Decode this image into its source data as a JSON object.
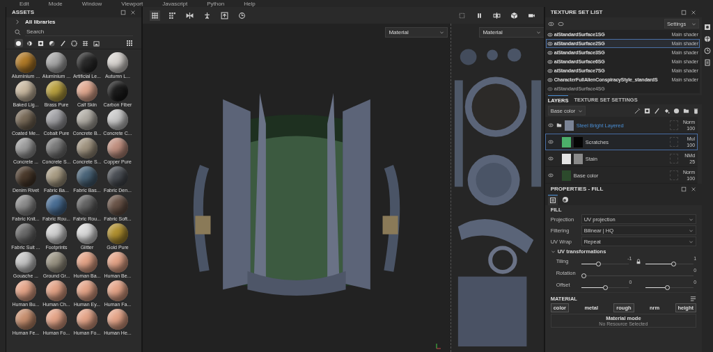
{
  "menu_bar": [
    "Edit",
    "Mode",
    "Window",
    "Viewport",
    "Javascript",
    "Python",
    "Help"
  ],
  "assets": {
    "title": "ASSETS",
    "library": "All libraries",
    "search": {
      "placeholder": "Search"
    },
    "filters": [
      {
        "kind": "sphere",
        "selected": true
      },
      {
        "kind": "smart",
        "selected": false
      },
      {
        "kind": "square",
        "selected": false
      },
      {
        "kind": "half",
        "selected": false
      },
      {
        "kind": "brush",
        "selected": false
      },
      {
        "kind": "particle",
        "selected": false
      },
      {
        "kind": "grid",
        "selected": false
      },
      {
        "kind": "image",
        "selected": false
      }
    ],
    "items": [
      {
        "name": "Aluminium ...",
        "color": "#b07a28"
      },
      {
        "name": "Aluminium ...",
        "color": "#a8a8a8"
      },
      {
        "name": "Artificial Le...",
        "color": "#2a2a2a"
      },
      {
        "name": "Autumn L...",
        "color": "#d8d4d0"
      },
      {
        "name": "Baked Lig...",
        "color": "#c8b8a0"
      },
      {
        "name": "Brass Pure",
        "color": "#b8a040"
      },
      {
        "name": "Calf Skin",
        "color": "#e0a890"
      },
      {
        "name": "Carbon Fiber",
        "color": "#1c1c1c"
      },
      {
        "name": "Coated Me...",
        "color": "#786a58"
      },
      {
        "name": "Cobalt Pure",
        "color": "#a0a0a4"
      },
      {
        "name": "Concrete B...",
        "color": "#b0aca4"
      },
      {
        "name": "Concrete C...",
        "color": "#c8c8c8"
      },
      {
        "name": "Concrete ...",
        "color": "#9c9c9c"
      },
      {
        "name": "Concrete S...",
        "color": "#7a7a7a"
      },
      {
        "name": "Concrete S...",
        "color": "#a09480"
      },
      {
        "name": "Copper Pure",
        "color": "#c09080"
      },
      {
        "name": "Denim Rivet",
        "color": "#4a3a2c"
      },
      {
        "name": "Fabric Ba...",
        "color": "#a89c84"
      },
      {
        "name": "Fabric Bas...",
        "color": "#4a6478"
      },
      {
        "name": "Fabric Den...",
        "color": "#4a4e54"
      },
      {
        "name": "Fabric Knit...",
        "color": "#8c8c8c"
      },
      {
        "name": "Fabric Rou...",
        "color": "#4a6e94"
      },
      {
        "name": "Fabric Rou...",
        "color": "#646464"
      },
      {
        "name": "Fabric Soft...",
        "color": "#6a5448"
      },
      {
        "name": "Fabric Suit ...",
        "color": "#6a6a6a"
      },
      {
        "name": "Footprints",
        "color": "#d0d0d0"
      },
      {
        "name": "Glitter",
        "color": "#d8d8d8"
      },
      {
        "name": "Gold Pure",
        "color": "#b09030"
      },
      {
        "name": "Gouache ...",
        "color": "#c4c4c4"
      },
      {
        "name": "Ground Gr...",
        "color": "#9a9484"
      },
      {
        "name": "Human Ba...",
        "color": "#e4a488"
      },
      {
        "name": "Human Be...",
        "color": "#e4a488"
      },
      {
        "name": "Human Bu...",
        "color": "#e4a488"
      },
      {
        "name": "Human Ch...",
        "color": "#e2a286"
      },
      {
        "name": "Human Ey...",
        "color": "#e4a488"
      },
      {
        "name": "Human Fa...",
        "color": "#e4a488"
      },
      {
        "name": "Human Fe...",
        "color": "#c89070"
      },
      {
        "name": "Human Fo...",
        "color": "#e4a488"
      },
      {
        "name": "Human Fo...",
        "color": "#e4a488"
      },
      {
        "name": "Human He...",
        "color": "#e4a488"
      }
    ]
  },
  "viewport": {
    "dropdowns": [
      "Material",
      "Material"
    ]
  },
  "texture_set_list": {
    "title": "TEXTURE SET LIST",
    "settings": "Settings",
    "items": [
      {
        "name": "aiStandardSurface1SG",
        "shader": "Main shader",
        "selected": false,
        "faded": false
      },
      {
        "name": "aiStandardSurface2SG",
        "shader": "Main shader",
        "selected": true,
        "faded": false
      },
      {
        "name": "aiStandardSurface3SG",
        "shader": "Main shader",
        "selected": false,
        "faded": false
      },
      {
        "name": "aiStandardSurface6SG",
        "shader": "Main shader",
        "selected": false,
        "faded": false
      },
      {
        "name": "aiStandardSurface7SG",
        "shader": "Main shader",
        "selected": false,
        "faded": false
      },
      {
        "name": "CharacterFullAlienConspiracyStyle_standardS",
        "shader": "Main shader",
        "selected": false,
        "faded": false
      },
      {
        "name": "aiStandardSurface4SG",
        "selected": false,
        "faded": true
      }
    ]
  },
  "layers": {
    "tabs": [
      {
        "label": "LAYERS",
        "selected": true
      },
      {
        "label": "TEXTURE SET SETTINGS",
        "selected": false
      }
    ],
    "channel": "Base color",
    "items": [
      {
        "kind": "folder",
        "name": "Steel Bright Layered",
        "blend": "Norm",
        "opacity": "100",
        "selected": false,
        "color": "#7b8496"
      },
      {
        "kind": "fill",
        "name": "Scratches",
        "blend": "Mul",
        "opacity": "100",
        "selected": true,
        "color": "#4caf6a",
        "mask": {
          "color": "#050505"
        }
      },
      {
        "kind": "fill",
        "name": "Stain",
        "blend": "NMd",
        "opacity": "25",
        "selected": false,
        "color": "#e4e4e4",
        "mask": {
          "color": "#8a8a8a"
        }
      },
      {
        "kind": "paint",
        "name": "Base color",
        "blend": "Norm",
        "opacity": "100",
        "selected": false,
        "color": "#2c4a2c"
      }
    ]
  },
  "properties": {
    "title": "PROPERTIES - FILL",
    "section": "FILL",
    "fields": [
      {
        "label": "Projection",
        "value": "UV projection"
      },
      {
        "label": "Filtering",
        "value": "Bilinear | HQ"
      },
      {
        "label": "UV Wrap",
        "value": "Repeat"
      }
    ],
    "uv_group": {
      "label": "UV transformations",
      "expanded": true
    },
    "transforms": [
      {
        "label": "Tiling",
        "linked": true,
        "sliders": [
          {
            "reading": "-1",
            "level": 0.35
          },
          {
            "reading": "1",
            "level": 0.6
          }
        ]
      },
      {
        "label": "Rotation",
        "linked": false,
        "sliders": [
          {
            "reading": "0",
            "level": 0
          }
        ]
      },
      {
        "label": "Offset",
        "linked": false,
        "sliders": [
          {
            "reading": "0",
            "level": 0.5
          },
          {
            "reading": "0",
            "level": 0.45
          }
        ]
      }
    ],
    "material": {
      "title": "MATERIAL",
      "channels": [
        {
          "label": "color",
          "on": true
        },
        {
          "label": "metal",
          "on": false
        },
        {
          "label": "rough",
          "on": true
        },
        {
          "label": "nrm",
          "on": false
        },
        {
          "label": "height",
          "on": true
        }
      ],
      "mode": "Material mode",
      "note": "No Resource Selected"
    }
  }
}
